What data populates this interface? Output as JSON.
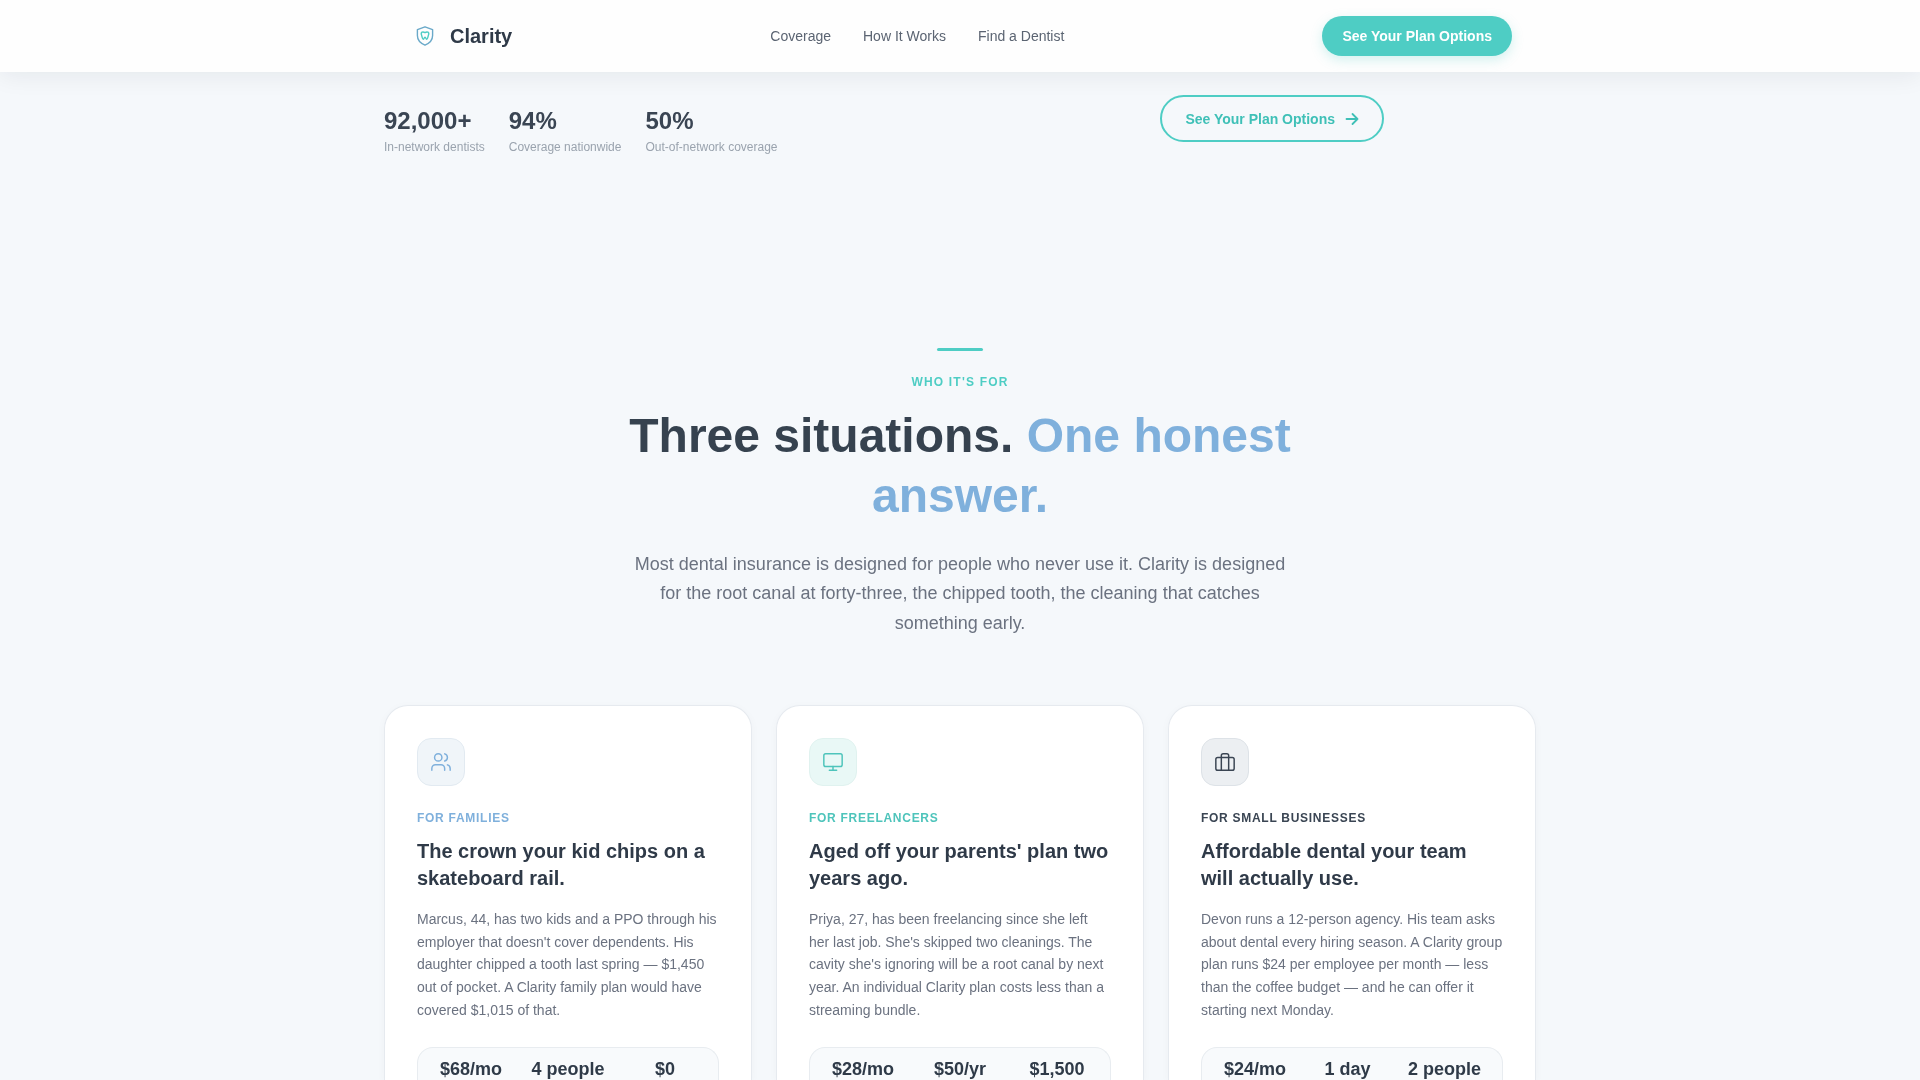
{
  "header": {
    "brand": "Clarity",
    "nav": [
      "Coverage",
      "How It Works",
      "Find a Dentist"
    ],
    "cta": "See Your Plan Options"
  },
  "hero": {
    "stats": [
      {
        "value": "92,000+",
        "label": "In-network dentists"
      },
      {
        "value": "94%",
        "label": "Coverage nationwide"
      },
      {
        "value": "50%",
        "label": "Out-of-network coverage"
      }
    ],
    "cta": "See Your Plan Options"
  },
  "section": {
    "eyebrow": "WHO IT'S FOR",
    "heading": "Three situations.",
    "heading_accent": "One honest answer.",
    "intro": "Most dental insurance is designed for people who never use it. Clarity is designed for the root canal at forty-three, the chipped tooth, the cleaning that catches something early."
  },
  "cards": [
    {
      "kind": "families",
      "eyebrow": "FOR FAMILIES",
      "title": "The crown your kid chips on a skateboard rail.",
      "body": "Marcus, 44, has two kids and a PPO through his employer that doesn't cover dependents. His daughter chipped a tooth last spring — $1,450 out of pocket. A Clarity family plan would have covered $1,015 of that.",
      "stats": [
        "$68/mo",
        "4 people",
        "$0"
      ]
    },
    {
      "kind": "freelancers",
      "eyebrow": "FOR FREELANCERS",
      "title": "Aged off your parents' plan two years ago.",
      "body": "Priya, 27, has been freelancing since she left her last job. She's skipped two cleanings. The cavity she's ignoring will be a root canal by next year. An individual Clarity plan costs less than a streaming bundle.",
      "stats": [
        "$28/mo",
        "$50/yr",
        "$1,500"
      ]
    },
    {
      "kind": "business",
      "eyebrow": "FOR SMALL BUSINESSES",
      "title": "Affordable dental your team will actually use.",
      "body": "Devon runs a 12-person agency. His team asks about dental every hiring season. A Clarity group plan runs $24 per employee per month — less than the coffee budget — and he can offer it starting next Monday.",
      "stats": [
        "$24/mo",
        "1 day",
        "2 people"
      ]
    }
  ]
}
